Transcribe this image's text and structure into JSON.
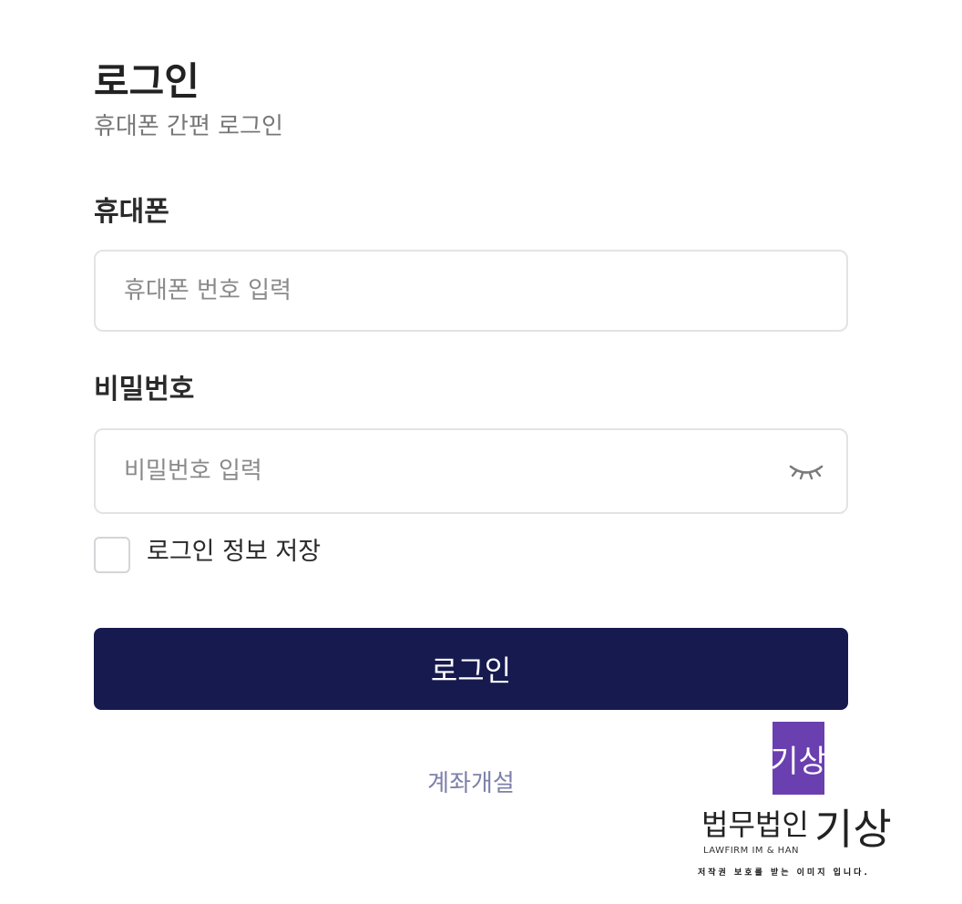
{
  "header": {
    "title": "로그인",
    "subtitle": "휴대폰 간편 로그인"
  },
  "form": {
    "phone": {
      "label": "휴대폰",
      "placeholder": "휴대폰 번호 입력",
      "value": ""
    },
    "password": {
      "label": "비밀번호",
      "placeholder": "비밀번호 입력",
      "value": "",
      "toggle_icon": "eye-closed-icon"
    },
    "remember": {
      "label": "로그인 정보 저장",
      "checked": false
    },
    "submit_label": "로그인",
    "signup_link": "계좌개설"
  },
  "watermark": {
    "logo_text": "기상",
    "firm_name": "법무법인",
    "firm_name_big": "기상",
    "firm_name_en": "LAWFIRM IM & HAN",
    "notice": "저작권 보호를 받는 이미지 입니다."
  },
  "colors": {
    "primary": "#161a4f",
    "link": "#7d80a8",
    "logo": "#6a3fb0"
  }
}
